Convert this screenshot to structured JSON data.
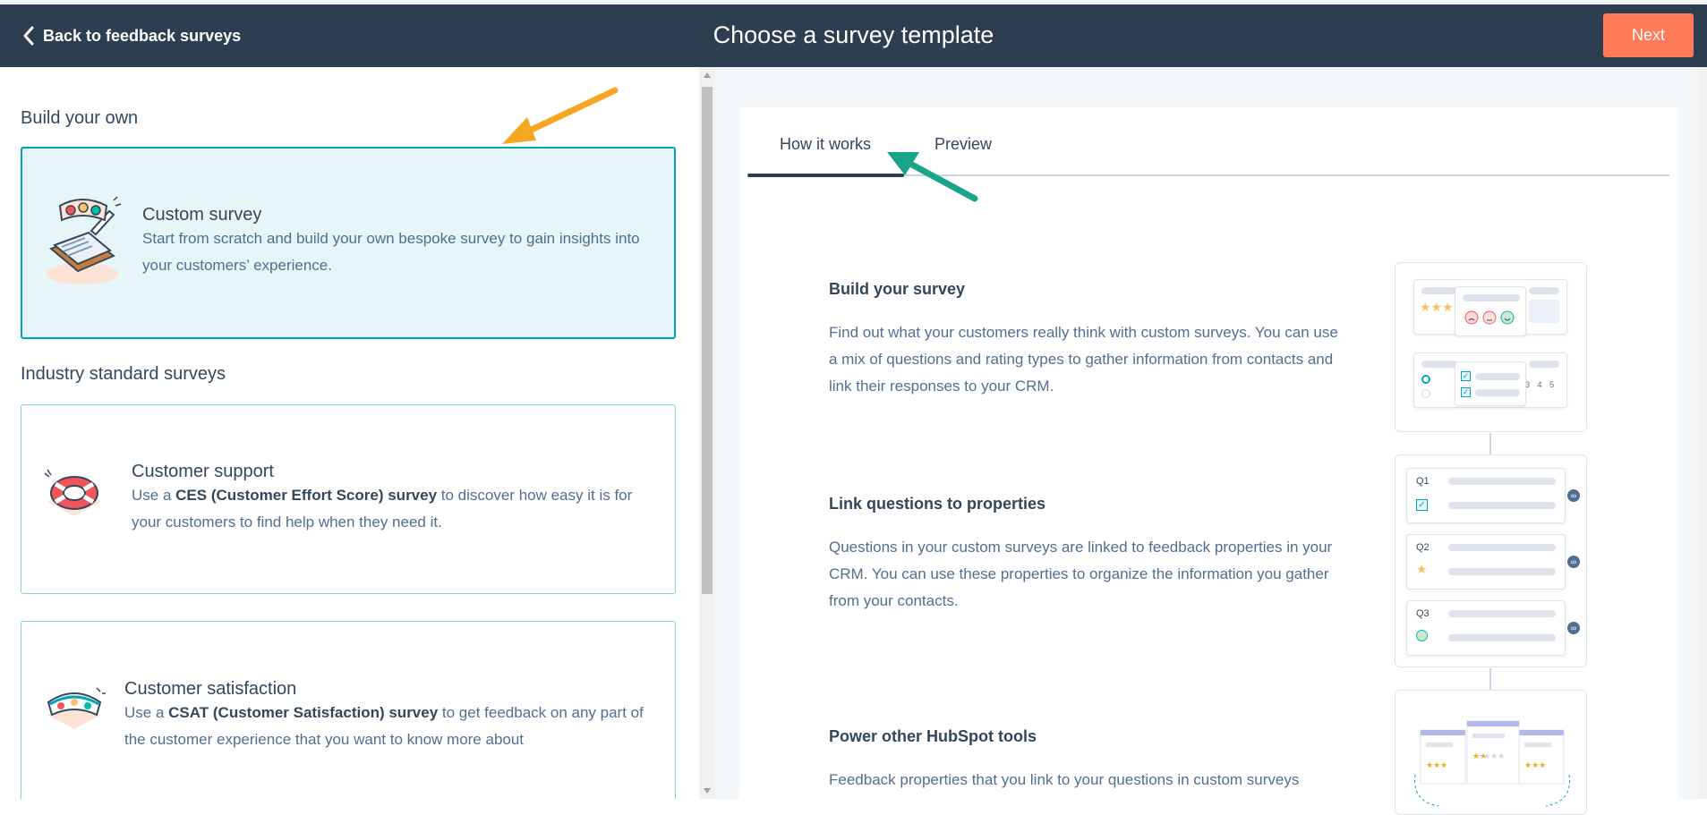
{
  "header": {
    "back_label": "Back to feedback surveys",
    "title": "Choose a survey template",
    "next_label": "Next",
    "bg_color": "#2d3e50",
    "next_color": "#ff7a59"
  },
  "left": {
    "build_heading": "Build your own",
    "industry_heading": "Industry standard surveys",
    "custom": {
      "title": "Custom survey",
      "desc": "Start from scratch and build your own bespoke survey to gain insights into your customers’ experience."
    },
    "support": {
      "title": "Customer support",
      "desc_prefix": "Use a ",
      "desc_bold": "CES (Customer Effort Score) survey",
      "desc_suffix": " to discover how easy it is for your customers to find help when they need it."
    },
    "satisfaction": {
      "title": "Customer satisfaction",
      "desc_prefix": "Use a ",
      "desc_bold": "CSAT (Customer Satisfaction) survey",
      "desc_suffix": " to get feedback on any part of the customer experience that you want to know more about"
    }
  },
  "right": {
    "tabs": [
      "How it works",
      "Preview"
    ],
    "active_tab": "How it works",
    "steps": [
      {
        "title": "Build your survey",
        "desc": "Find out what your customers really think with custom surveys. You can use a mix of questions and rating types to gather information from contacts and link their responses to your CRM."
      },
      {
        "title": "Link questions to properties",
        "desc": "Questions in your custom surveys are linked to feedback properties in your CRM. You can use these properties to organize the information you gather from your contacts."
      },
      {
        "title": "Power other HubSpot tools",
        "desc": "Feedback properties that you link to your questions in custom surveys"
      }
    ],
    "question_labels": [
      "Q1",
      "Q2",
      "Q3"
    ],
    "rating_numbers": [
      "3",
      "4",
      "5"
    ]
  },
  "annotation_colors": {
    "orange_arrow": "#f5a623",
    "green_arrow": "#1aa58a"
  }
}
